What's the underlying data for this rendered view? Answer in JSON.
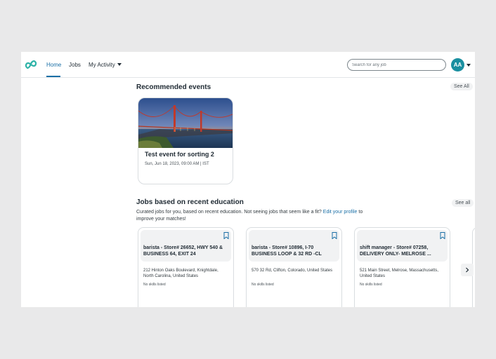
{
  "nav": {
    "home": "Home",
    "jobs": "Jobs",
    "my_activity": "My Activity"
  },
  "search": {
    "placeholder": "Search for any job"
  },
  "user": {
    "initials": "AA"
  },
  "colors": {
    "accent": "#1a6fa6",
    "avatar": "#1a8fa0"
  },
  "events": {
    "heading": "Recommended events",
    "see_all": "See All",
    "items": [
      {
        "title": "Test event for sorting 2",
        "date": "Sun, Jun 18, 2023, 09:00 AM | IST"
      }
    ]
  },
  "jobs": {
    "heading": "Jobs based on recent education",
    "see_all": "See all",
    "subtitle_prefix": "Curated jobs for you, based on recent education. Not seeing jobs that seem like a fit?",
    "subtitle_link": "Edit your profile",
    "subtitle_suffix": "to improve your matches!",
    "items": [
      {
        "title": "barista - Store# 26652, HWY 540 & BUSINESS 64, EXIT 24",
        "address": "212 Hinton Oaks Boulevard, Knightdale, North Carolina, United States",
        "skills": "No skills listed"
      },
      {
        "title": "barista - Store# 10896, I-70 BUSINESS LOOP & 32 RD -CL",
        "address": "570 32 Rd, Clifton, Colorado, United States",
        "skills": "No skills listed"
      },
      {
        "title": "shift manager - Store# 07258, DELIVERY ONLY- MELROSE ...",
        "address": "521 Main Street, Melrose, Massachusetts, United States",
        "skills": "No skills listed"
      }
    ]
  }
}
